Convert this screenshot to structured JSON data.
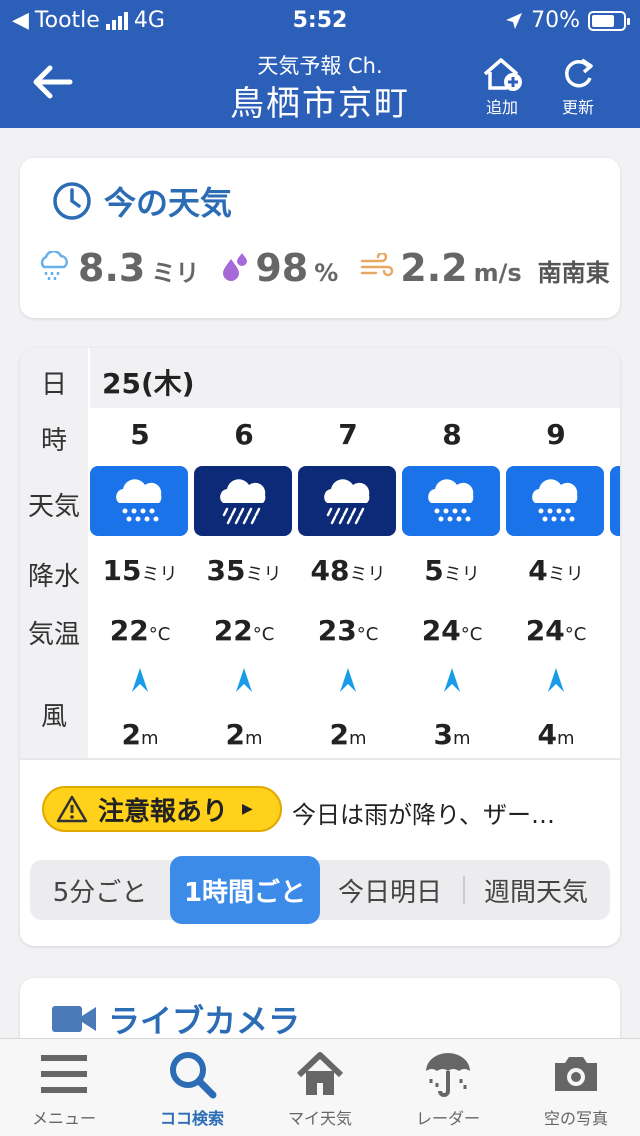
{
  "status": {
    "carrier": "Tootle",
    "network": "4G",
    "time": "5:52",
    "battery": "70%"
  },
  "header": {
    "subtitle": "天気予報 Ch.",
    "title": "鳥栖市京町",
    "add_label": "追加",
    "refresh_label": "更新"
  },
  "now": {
    "title": "今の天気",
    "precip_value": "8.3",
    "precip_unit": "ミリ",
    "humidity_value": "98",
    "humidity_unit": "%",
    "wind_value": "2.2",
    "wind_unit": "m/s",
    "wind_dir": "南南東"
  },
  "forecast": {
    "labels": {
      "day": "日",
      "hour": "時",
      "weather": "天気",
      "precip": "降水",
      "temp": "気温",
      "wind": "風"
    },
    "date": "25(木)",
    "precip_unit": "ミリ",
    "temp_unit": "°C",
    "wind_unit": "m",
    "hours": [
      {
        "hour": "5",
        "weather": "rain",
        "precip": "15",
        "temp": "22",
        "wind": "2"
      },
      {
        "hour": "6",
        "weather": "heavy-rain",
        "precip": "35",
        "temp": "22",
        "wind": "2"
      },
      {
        "hour": "7",
        "weather": "heavy-rain",
        "precip": "48",
        "temp": "23",
        "wind": "2"
      },
      {
        "hour": "8",
        "weather": "rain",
        "precip": "5",
        "temp": "24",
        "wind": "3"
      },
      {
        "hour": "9",
        "weather": "rain",
        "precip": "4",
        "temp": "24",
        "wind": "4"
      }
    ]
  },
  "alert": {
    "badge": "注意報あり",
    "text": "今日は雨が降り、ザー…"
  },
  "segments": {
    "s1": "5分ごと",
    "s2": "1時間ごと",
    "s3": "今日明日",
    "s4": "週間天気"
  },
  "live": {
    "title": "ライブカメラ"
  },
  "tabs": {
    "menu": "メニュー",
    "search": "ココ検索",
    "my": "マイ天気",
    "radar": "レーダー",
    "photo": "空の写真"
  },
  "colors": {
    "brand": "#2c5fb8",
    "rain_blue": "#1a73e8",
    "heavy_rain_navy": "#0d2a78",
    "alert_yellow": "#ffd11a",
    "active_segment": "#3d8be8"
  }
}
